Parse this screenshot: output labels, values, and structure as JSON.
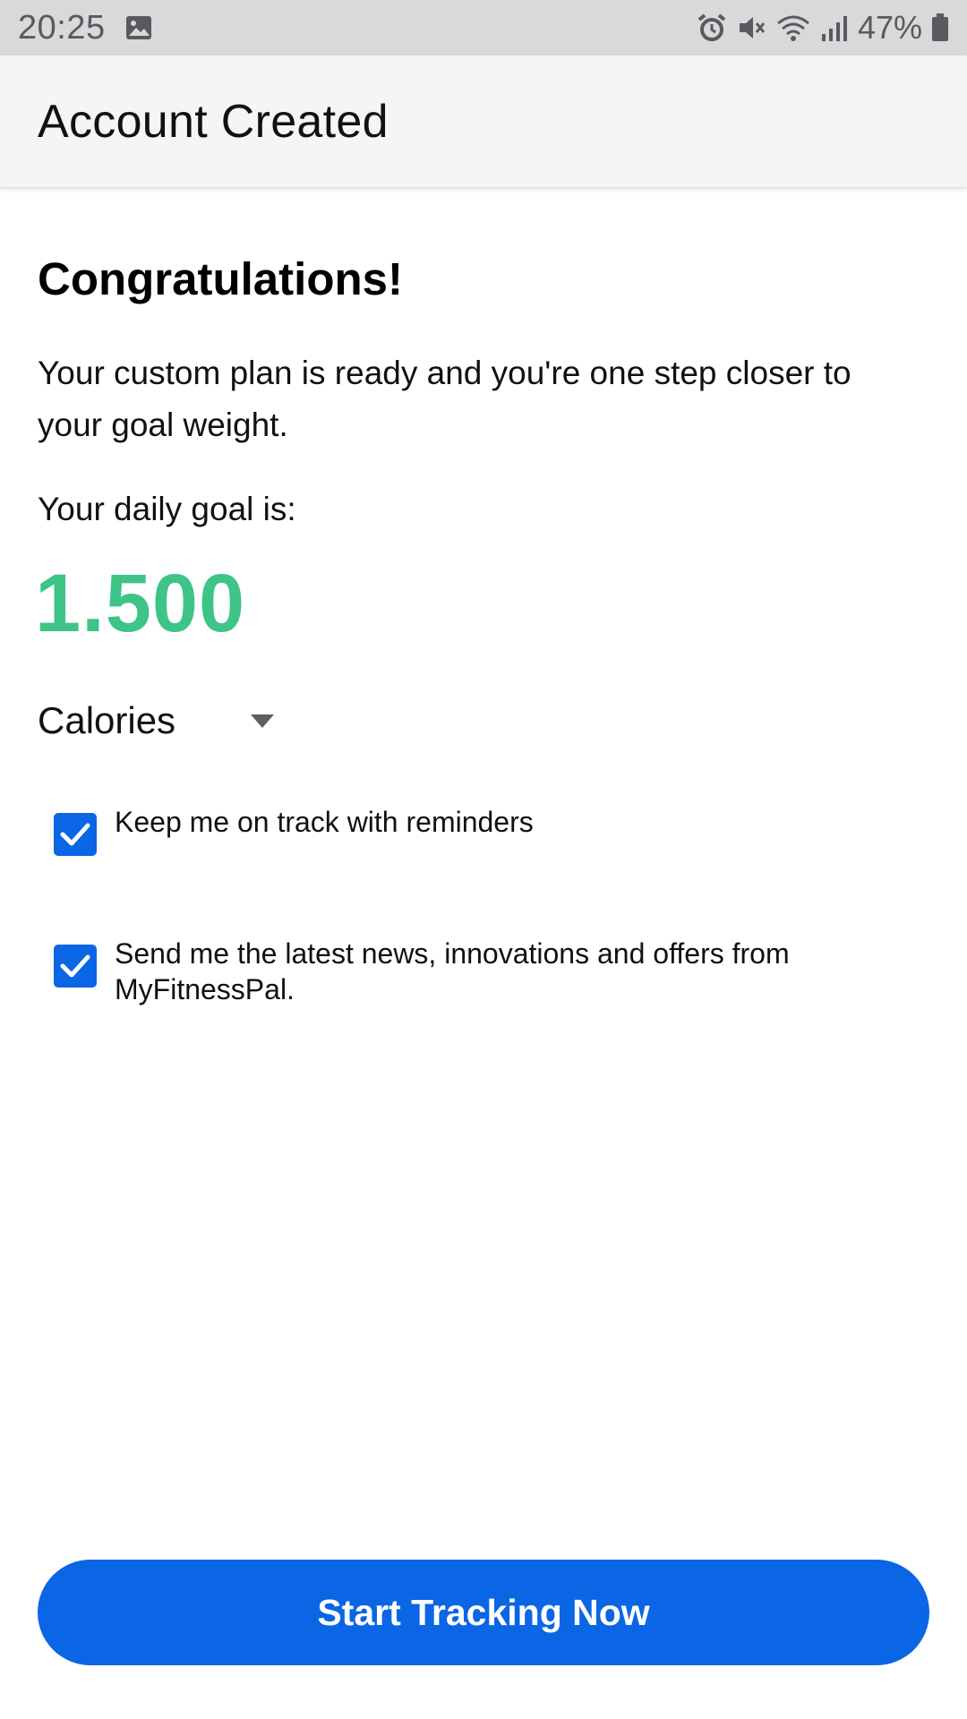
{
  "status_bar": {
    "time": "20:25",
    "battery_percent": "47%",
    "icons": [
      "gallery-icon",
      "alarm-icon",
      "mute-icon",
      "wifi-icon",
      "signal-icon",
      "battery-icon"
    ]
  },
  "header": {
    "title": "Account Created"
  },
  "main": {
    "heading": "Congratulations!",
    "intro": "Your custom plan is ready and you're one step closer to your goal weight.",
    "daily_goal_label": "Your daily goal is:",
    "goal_value": "1.500",
    "unit_select": {
      "selected": "Calories"
    },
    "checkboxes": [
      {
        "label": "Keep me on track with reminders",
        "checked": true
      },
      {
        "label": "Send me the latest news, innovations and offers from MyFitnessPal.",
        "checked": true
      }
    ]
  },
  "footer": {
    "cta_label": "Start Tracking Now"
  },
  "colors": {
    "accent": "#0a66e4",
    "goal_green": "#3dc486",
    "status_bar": "#d9d9db",
    "header_bg": "#f5f5f7"
  }
}
